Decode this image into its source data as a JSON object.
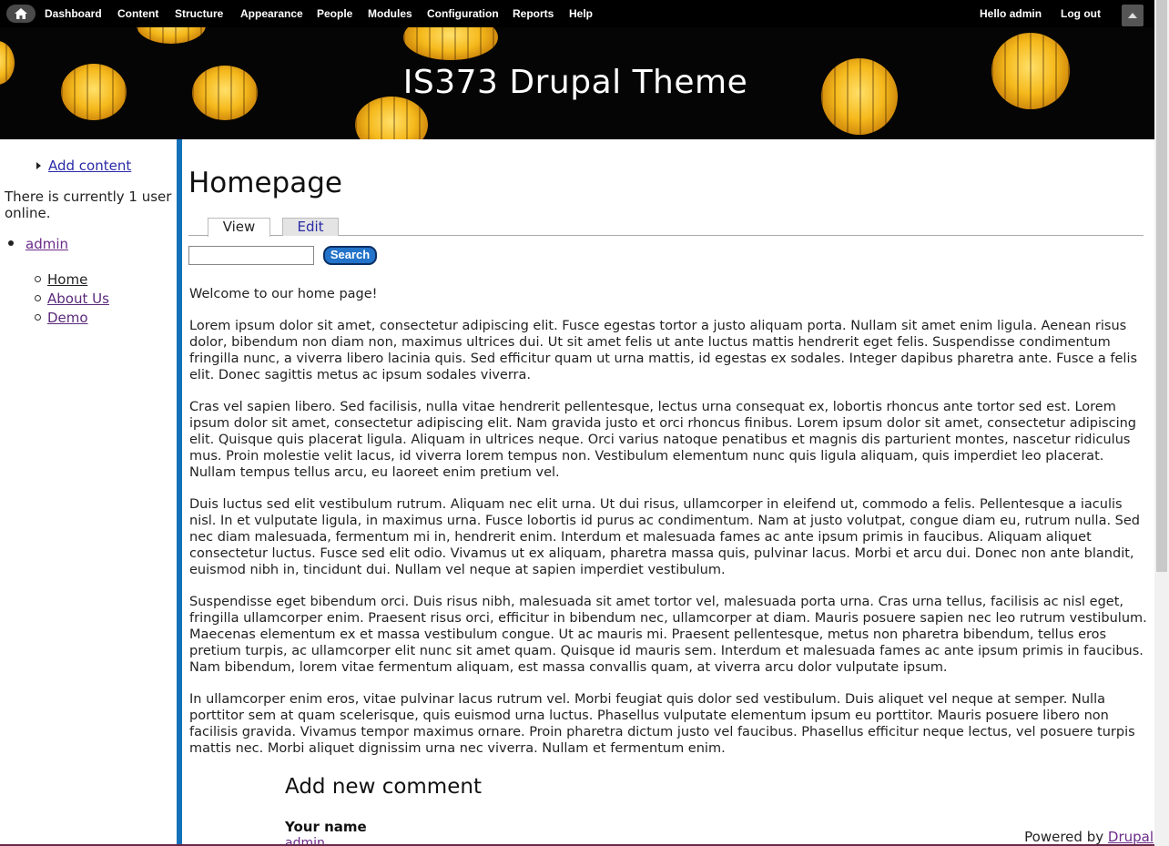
{
  "toolbar": {
    "items": [
      "Dashboard",
      "Content",
      "Structure",
      "Appearance",
      "People",
      "Modules",
      "Configuration",
      "Reports",
      "Help"
    ],
    "hello_prefix": "Hello",
    "user": "admin",
    "logout": "Log out"
  },
  "header": {
    "site_title": "IS373 Drupal Theme"
  },
  "sidebar": {
    "add_content": "Add content",
    "online_text": "There is currently 1 user online.",
    "online_user": "admin",
    "menu": [
      "Home",
      "About Us",
      "Demo"
    ]
  },
  "main": {
    "title": "Homepage",
    "tabs": [
      "View",
      "Edit"
    ],
    "search_button": "Search",
    "search_value": "",
    "paragraphs": [
      "Welcome to our home page!",
      "Lorem ipsum dolor sit amet, consectetur adipiscing elit. Fusce egestas tortor a justo aliquam porta. Nullam sit amet enim ligula. Aenean risus dolor, bibendum non diam non, maximus ultrices dui. Ut sit amet felis ut ante luctus mattis hendrerit eget felis. Suspendisse condimentum fringilla nunc, a viverra libero lacinia quis. Sed efficitur quam ut urna mattis, id egestas ex sodales. Integer dapibus pharetra ante. Fusce a felis elit. Donec sagittis metus ac ipsum sodales viverra.",
      "Cras vel sapien libero. Sed facilisis, nulla vitae hendrerit pellentesque, lectus urna consequat ex, lobortis rhoncus ante tortor sed est. Lorem ipsum dolor sit amet, consectetur adipiscing elit. Nam gravida justo et orci rhoncus finibus. Lorem ipsum dolor sit amet, consectetur adipiscing elit. Quisque quis placerat ligula. Aliquam in ultrices neque. Orci varius natoque penatibus et magnis dis parturient montes, nascetur ridiculus mus. Proin molestie velit lacus, id viverra lorem tempus non. Vestibulum elementum nunc quis ligula aliquam, quis imperdiet leo placerat. Nullam tempus tellus arcu, eu laoreet enim pretium vel.",
      "Duis luctus sed elit vestibulum rutrum. Aliquam nec elit urna. Ut dui risus, ullamcorper in eleifend ut, commodo a felis. Pellentesque a iaculis nisl. In et vulputate ligula, in maximus urna. Fusce lobortis id purus ac condimentum. Nam at justo volutpat, congue diam eu, rutrum nulla. Sed nec diam malesuada, fermentum mi in, hendrerit enim. Interdum et malesuada fames ac ante ipsum primis in faucibus. Aliquam aliquet consectetur luctus. Fusce sed elit odio. Vivamus ut ex aliquam, pharetra massa quis, pulvinar lacus. Morbi et arcu dui. Donec non ante blandit, euismod nibh in, tincidunt dui. Nullam vel neque at sapien imperdiet vestibulum.",
      "Suspendisse eget bibendum orci. Duis risus nibh, malesuada sit amet tortor vel, malesuada porta urna. Cras urna tellus, facilisis ac nisl eget, fringilla ullamcorper enim. Praesent risus orci, efficitur in bibendum nec, ullamcorper at diam. Mauris posuere sapien nec leo rutrum vestibulum. Maecenas elementum ex et massa vestibulum congue. Ut ac mauris mi. Praesent pellentesque, metus non pharetra bibendum, tellus eros pretium turpis, ac ullamcorper elit nunc sit amet quam. Quisque id mauris sem. Interdum et malesuada fames ac ante ipsum primis in faucibus. Nam bibendum, lorem vitae fermentum aliquam, est massa convallis quam, at viverra arcu dolor vulputate ipsum.",
      "In ullamcorper enim eros, vitae pulvinar lacus rutrum vel. Morbi feugiat quis dolor sed vestibulum. Duis aliquet vel neque at semper. Nulla porttitor sem at quam scelerisque, quis euismod urna luctus. Phasellus vulputate elementum ipsum eu porttitor. Mauris posuere libero non facilisis gravida. Vivamus tempor maximus ornare. Proin pharetra dictum justo vel faucibus. Phasellus efficitur neque lectus, vel posuere turpis mattis nec. Morbi aliquet dignissim urna nec viverra. Nullam et fermentum enim."
    ],
    "comment_heading": "Add new comment",
    "your_name_label": "Your name",
    "your_name_value": "admin"
  },
  "footer": {
    "powered_by": "Powered by",
    "powered_link": "Drupal"
  },
  "colors": {
    "toolbar_bg": "#000000",
    "sidebar_border": "#1471b9",
    "search_button": "#2273c9",
    "link": "#2a2aa8",
    "visited_link": "#6a2a8a"
  },
  "icons": {
    "home": "home-icon",
    "drawer": "triangle-up-icon"
  }
}
